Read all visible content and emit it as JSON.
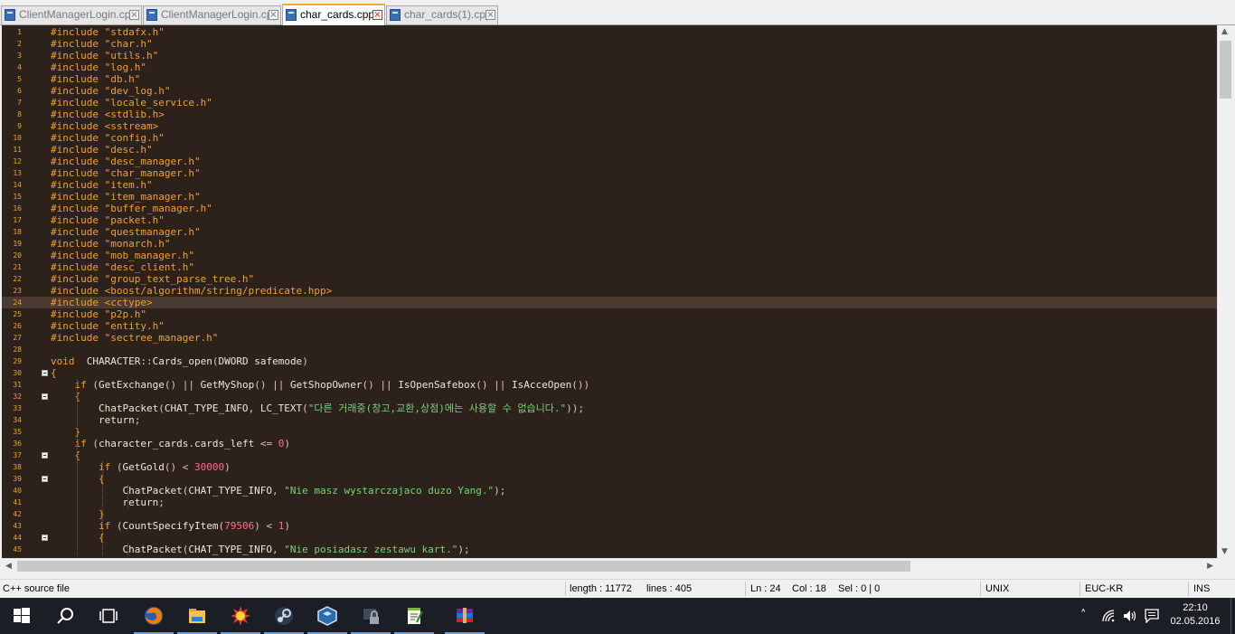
{
  "tabs": [
    {
      "label": "ClientManagerLogin.cpp",
      "active": false
    },
    {
      "label": "ClientManagerLogin.cpp",
      "active": false
    },
    {
      "label": "char_cards.cpp",
      "active": true
    },
    {
      "label": "char_cards(1).cpp",
      "active": false
    }
  ],
  "editor": {
    "current_line": 24,
    "fold_markers_at": [
      30,
      32,
      37,
      39,
      44
    ],
    "lines": [
      [
        [
          "pp",
          "#include \"stdafx.h\""
        ]
      ],
      [
        [
          "pp",
          "#include \"char.h\""
        ]
      ],
      [
        [
          "pp",
          "#include \"utils.h\""
        ]
      ],
      [
        [
          "pp",
          "#include \"log.h\""
        ]
      ],
      [
        [
          "pp",
          "#include \"db.h\""
        ]
      ],
      [
        [
          "pp",
          "#include \"dev_log.h\""
        ]
      ],
      [
        [
          "pp",
          "#include \"locale_service.h\""
        ]
      ],
      [
        [
          "pp",
          "#include <stdlib.h>"
        ]
      ],
      [
        [
          "pp",
          "#include <sstream>"
        ]
      ],
      [
        [
          "pp",
          "#include \"config.h\""
        ]
      ],
      [
        [
          "pp",
          "#include \"desc.h\""
        ]
      ],
      [
        [
          "pp",
          "#include \"desc_manager.h\""
        ]
      ],
      [
        [
          "pp",
          "#include \"char_manager.h\""
        ]
      ],
      [
        [
          "pp",
          "#include \"item.h\""
        ]
      ],
      [
        [
          "pp",
          "#include \"item_manager.h\""
        ]
      ],
      [
        [
          "pp",
          "#include \"buffer_manager.h\""
        ]
      ],
      [
        [
          "pp",
          "#include \"packet.h\""
        ]
      ],
      [
        [
          "pp",
          "#include \"questmanager.h\""
        ]
      ],
      [
        [
          "pp",
          "#include \"monarch.h\""
        ]
      ],
      [
        [
          "pp",
          "#include \"mob_manager.h\""
        ]
      ],
      [
        [
          "pp",
          "#include \"desc_client.h\""
        ]
      ],
      [
        [
          "pp",
          "#include \"group_text_parse_tree.h\""
        ]
      ],
      [
        [
          "pp",
          "#include <boost/algorithm/string/predicate.hpp>"
        ]
      ],
      [
        [
          "pp",
          "#include <cctype>"
        ]
      ],
      [
        [
          "pp",
          "#include \"p2p.h\""
        ]
      ],
      [
        [
          "pp",
          "#include \"entity.h\""
        ]
      ],
      [
        [
          "pp",
          "#include \"sectree_manager.h\""
        ]
      ],
      [],
      [
        [
          "pp",
          "void"
        ],
        [
          "",
          "  CHARACTER"
        ],
        [
          "op",
          "::"
        ],
        [
          "",
          "Cards_open"
        ],
        [
          "op",
          "("
        ],
        [
          "",
          "DWORD safemode"
        ],
        [
          "op",
          ")"
        ]
      ],
      [
        [
          "pp",
          "{"
        ]
      ],
      [
        [
          "",
          "    "
        ],
        [
          "pp",
          "if"
        ],
        [
          "op",
          " ("
        ],
        [
          "",
          "GetExchange"
        ],
        [
          "op",
          "() || "
        ],
        [
          "",
          "GetMyShop"
        ],
        [
          "op",
          "() || "
        ],
        [
          "",
          "GetShopOwner"
        ],
        [
          "op",
          "() || "
        ],
        [
          "",
          "IsOpenSafebox"
        ],
        [
          "op",
          "() || "
        ],
        [
          "",
          "IsAcceOpen"
        ],
        [
          "op",
          "())"
        ]
      ],
      [
        [
          "",
          "    "
        ],
        [
          "pp",
          "{"
        ]
      ],
      [
        [
          "",
          "        ChatPacket"
        ],
        [
          "op",
          "("
        ],
        [
          "",
          "CHAT_TYPE_INFO"
        ],
        [
          "op",
          ", "
        ],
        [
          "",
          "LC_TEXT"
        ],
        [
          "op",
          "("
        ],
        [
          "str",
          "\"다른 거래중(창고,교환,상점)에는 사용할 수 없습니다.\""
        ],
        [
          "op",
          "));"
        ]
      ],
      [
        [
          "",
          "        return"
        ],
        [
          "op",
          ";"
        ]
      ],
      [
        [
          "",
          "    "
        ],
        [
          "pp",
          "}"
        ]
      ],
      [
        [
          "",
          "    "
        ],
        [
          "pp",
          "if"
        ],
        [
          "op",
          " ("
        ],
        [
          "",
          "character_cards"
        ],
        [
          "op",
          "."
        ],
        [
          "",
          "cards_left "
        ],
        [
          "op",
          "<= "
        ],
        [
          "num",
          "0"
        ],
        [
          "op",
          ")"
        ]
      ],
      [
        [
          "",
          "    "
        ],
        [
          "pp",
          "{"
        ]
      ],
      [
        [
          "",
          "        "
        ],
        [
          "pp",
          "if"
        ],
        [
          "op",
          " ("
        ],
        [
          "",
          "GetGold"
        ],
        [
          "op",
          "() < "
        ],
        [
          "num",
          "30000"
        ],
        [
          "op",
          ")"
        ]
      ],
      [
        [
          "",
          "        "
        ],
        [
          "pp",
          "{"
        ]
      ],
      [
        [
          "",
          "            ChatPacket"
        ],
        [
          "op",
          "("
        ],
        [
          "",
          "CHAT_TYPE_INFO"
        ],
        [
          "op",
          ", "
        ],
        [
          "str",
          "\"Nie masz wystarczajaco duzo Yang.\""
        ],
        [
          "op",
          ");"
        ]
      ],
      [
        [
          "",
          "            return"
        ],
        [
          "op",
          ";"
        ]
      ],
      [
        [
          "",
          "        "
        ],
        [
          "pp",
          "}"
        ]
      ],
      [
        [
          "",
          "        "
        ],
        [
          "pp",
          "if"
        ],
        [
          "op",
          " ("
        ],
        [
          "",
          "CountSpecifyItem"
        ],
        [
          "op",
          "("
        ],
        [
          "num",
          "79506"
        ],
        [
          "op",
          ") < "
        ],
        [
          "num",
          "1"
        ],
        [
          "op",
          ")"
        ]
      ],
      [
        [
          "",
          "        "
        ],
        [
          "pp",
          "{"
        ]
      ],
      [
        [
          "",
          "            ChatPacket"
        ],
        [
          "op",
          "("
        ],
        [
          "",
          "CHAT_TYPE_INFO"
        ],
        [
          "op",
          ", "
        ],
        [
          "str",
          "\"Nie posiadasz zestawu kart.\""
        ],
        [
          "op",
          ");"
        ]
      ]
    ]
  },
  "status": {
    "filetype": "C++ source file",
    "length": "length : 11772",
    "lines": "lines : 405",
    "ln": "Ln : 24",
    "col": "Col : 18",
    "sel": "Sel : 0 | 0",
    "eol": "UNIX",
    "encoding": "EUC-KR",
    "mode": "INS"
  },
  "taskbar": {
    "apps": [
      "start-icon",
      "search-icon",
      "task-view-icon",
      "firefox-icon",
      "file-explorer-icon",
      "sun-app-icon",
      "steam-icon",
      "virtualbox-icon",
      "lock-app-icon",
      "notepadpp-icon",
      "winrar-icon"
    ],
    "time": "22:10",
    "date": "02.05.2016"
  },
  "colors": {
    "editor_bg": "#2d221b",
    "current_line_bg": "#4a3a30",
    "preprocessor": "#f0a030",
    "string": "#78d27a",
    "number": "#ff6b8a",
    "line_number": "#e5a52a",
    "tab_accent": "#f9a825",
    "taskbar_bg": "#1b1e24"
  }
}
